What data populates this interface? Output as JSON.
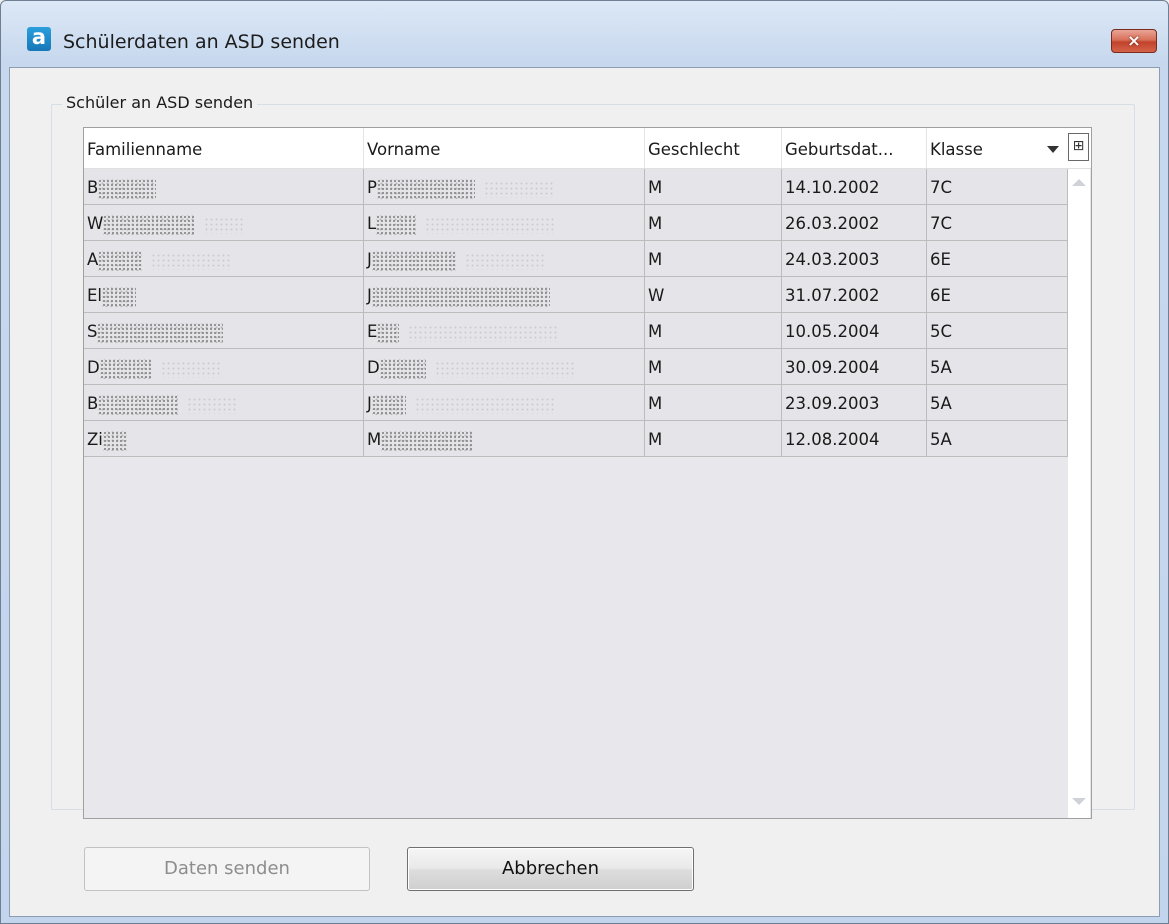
{
  "window": {
    "title": "Schülerdaten an ASD senden",
    "app_icon_letter": "a",
    "close_label": "×"
  },
  "group": {
    "label": "Schüler an ASD senden"
  },
  "grid": {
    "columns": [
      "Familienname",
      "Vorname",
      "Geschlecht",
      "Geburtsdat...",
      "Klasse"
    ],
    "column_chooser_icon": "column-chooser-icon",
    "filter_icon": "dropdown-arrow-icon",
    "rows": [
      {
        "familienname": "B",
        "vorname": "P",
        "geschlecht": "M",
        "geburtsdatum": "14.10.2002",
        "klasse": "7C"
      },
      {
        "familienname": "W",
        "vorname": "L",
        "geschlecht": "M",
        "geburtsdatum": "26.03.2002",
        "klasse": "7C"
      },
      {
        "familienname": "A",
        "vorname": "J",
        "geschlecht": "M",
        "geburtsdatum": "24.03.2003",
        "klasse": "6E"
      },
      {
        "familienname": "El",
        "vorname": "J",
        "geschlecht": "W",
        "geburtsdatum": "31.07.2002",
        "klasse": "6E"
      },
      {
        "familienname": "S",
        "vorname": "E",
        "geschlecht": "M",
        "geburtsdatum": "10.05.2004",
        "klasse": "5C"
      },
      {
        "familienname": "D",
        "vorname": "D",
        "geschlecht": "M",
        "geburtsdatum": "30.09.2004",
        "klasse": "5A"
      },
      {
        "familienname": "B",
        "vorname": "J",
        "geschlecht": "M",
        "geburtsdatum": "23.09.2003",
        "klasse": "5A"
      },
      {
        "familienname": "Zi",
        "vorname": "M",
        "geschlecht": "M",
        "geburtsdatum": "12.08.2004",
        "klasse": "5A"
      }
    ]
  },
  "buttons": {
    "send_label": "Daten senden",
    "send_enabled": false,
    "cancel_label": "Abbrechen"
  }
}
